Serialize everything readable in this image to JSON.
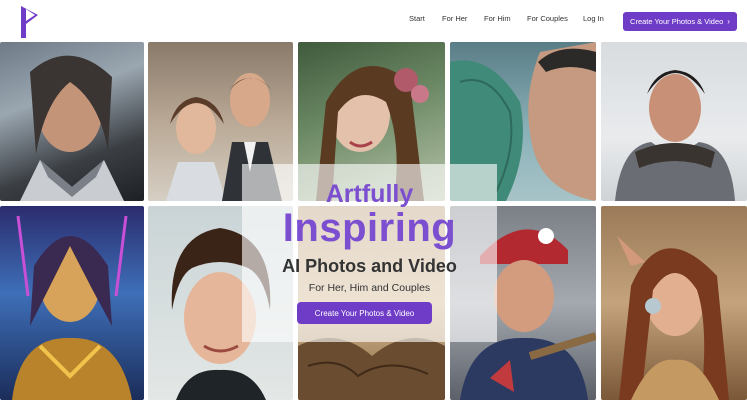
{
  "brand": {
    "logo_icon": "p-logo-icon",
    "accent": "#6f3cc8"
  },
  "nav": {
    "items": [
      "Start",
      "For Her",
      "For Him",
      "For Couples",
      "Log In"
    ],
    "cta_label": "Create Your Photos & Video",
    "cta_icon": "chevron-right-icon"
  },
  "hero": {
    "line1": "Artfully",
    "line2": "Inspiring",
    "line3": "AI Photos and Video",
    "line4": "For Her, Him and Couples",
    "cta_label": "Create Your Photos & Video"
  },
  "gallery": {
    "tiles": [
      "portrait-warrior-man-armor",
      "portrait-couple-formal",
      "portrait-woman-roses",
      "portrait-green-reptile-face",
      "portrait-man-armor-fur",
      "portrait-woman-neon-armor",
      "portrait-man-curly-hair",
      "portrait-woman-sepia",
      "portrait-baseball-player",
      "portrait-elf-woman"
    ]
  }
}
